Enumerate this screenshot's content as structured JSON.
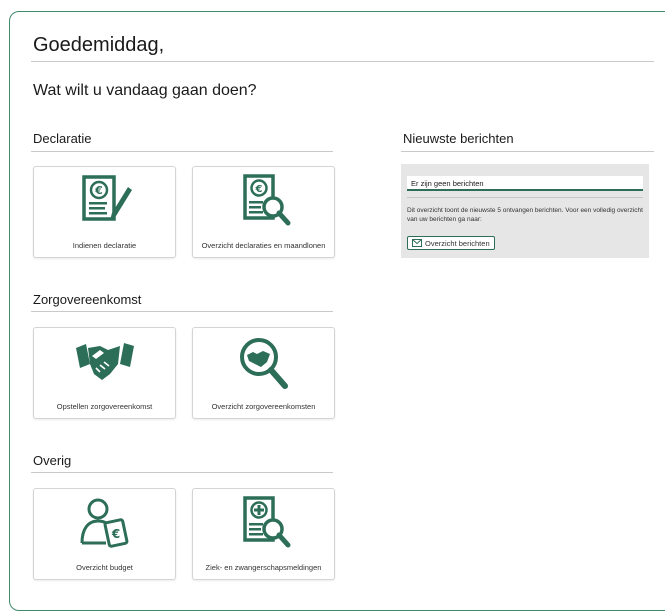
{
  "greeting": "Goedemiddag,",
  "question": "Wat wilt u vandaag gaan doen?",
  "sections": [
    {
      "title": "Declaratie",
      "tiles": [
        {
          "label": "Indienen declaratie",
          "icon": "euro-document-pen-icon"
        },
        {
          "label": "Overzicht declaraties en maandlonen",
          "icon": "euro-document-search-icon"
        }
      ]
    },
    {
      "title": "Zorgovereenkomst",
      "tiles": [
        {
          "label": "Opstellen zorgovereenkomst",
          "icon": "handshake-icon"
        },
        {
          "label": "Overzicht zorgovereenkomsten",
          "icon": "handshake-search-icon"
        }
      ]
    },
    {
      "title": "Overig",
      "tiles": [
        {
          "label": "Overzicht budget",
          "icon": "person-euro-icon"
        },
        {
          "label": "Ziek- en zwangerschapsmeldingen",
          "icon": "medical-document-search-icon"
        }
      ]
    }
  ],
  "news": {
    "title": "Nieuwste berichten",
    "empty": "Er zijn geen berichten",
    "info": "Dit overzicht toont de nieuwste 5 ontvangen berichten. Voor een volledig overzicht van uw berichten ga naar:",
    "button": "Overzicht berichten",
    "button_icon": "envelope-icon"
  },
  "colors": {
    "accent": "#2c6e57",
    "panel": "#e6e6e6"
  }
}
